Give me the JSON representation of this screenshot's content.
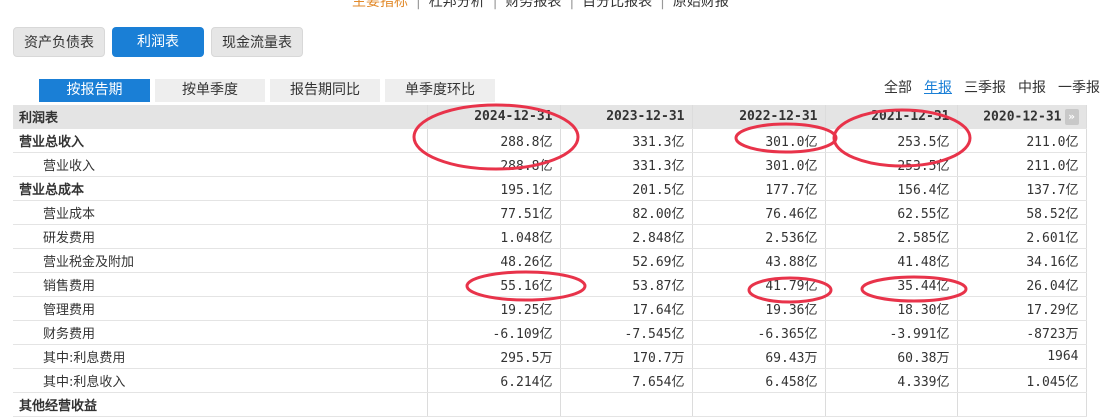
{
  "top_nav": {
    "items": [
      "主要指标",
      "杜邦分析",
      "财务报表",
      "百分比报表",
      "原始财报"
    ],
    "separator": "|"
  },
  "statement_tabs": [
    "资产负债表",
    "利润表",
    "现金流量表"
  ],
  "view_tabs": [
    "按报告期",
    "按单季度",
    "报告期同比",
    "单季度环比"
  ],
  "period_filters": [
    "全部",
    "年报",
    "三季报",
    "中报",
    "一季报"
  ],
  "table": {
    "header": [
      "利润表",
      "2024-12-31",
      "2023-12-31",
      "2022-12-31",
      "2021-12-31",
      "2020-12-31"
    ],
    "next_icon": "»",
    "rows": [
      {
        "label": "营业总收入",
        "values": [
          "288.8亿",
          "331.3亿",
          "301.0亿",
          "253.5亿",
          "211.0亿"
        ]
      },
      {
        "label": "营业收入",
        "values": [
          "288.8亿",
          "331.3亿",
          "301.0亿",
          "253.5亿",
          "211.0亿"
        ]
      },
      {
        "label": "营业总成本",
        "values": [
          "195.1亿",
          "201.5亿",
          "177.7亿",
          "156.4亿",
          "137.7亿"
        ]
      },
      {
        "label": "营业成本",
        "values": [
          "77.51亿",
          "82.00亿",
          "76.46亿",
          "62.55亿",
          "58.52亿"
        ]
      },
      {
        "label": "研发费用",
        "values": [
          "1.048亿",
          "2.848亿",
          "2.536亿",
          "2.585亿",
          "2.601亿"
        ]
      },
      {
        "label": "营业税金及附加",
        "values": [
          "48.26亿",
          "52.69亿",
          "43.88亿",
          "41.48亿",
          "34.16亿"
        ]
      },
      {
        "label": "销售费用",
        "values": [
          "55.16亿",
          "53.87亿",
          "41.79亿",
          "35.44亿",
          "26.04亿"
        ]
      },
      {
        "label": "管理费用",
        "values": [
          "19.25亿",
          "17.64亿",
          "19.36亿",
          "18.30亿",
          "17.29亿"
        ]
      },
      {
        "label": "财务费用",
        "values": [
          "-6.109亿",
          "-7.545亿",
          "-6.365亿",
          "-3.991亿",
          "-8723万"
        ]
      },
      {
        "label": "其中:利息费用",
        "values": [
          "295.5万",
          "170.7万",
          "69.43万",
          "60.38万",
          "1964"
        ]
      },
      {
        "label": "其中:利息收入",
        "values": [
          "6.214亿",
          "7.654亿",
          "6.458亿",
          "4.339亿",
          "1.045亿"
        ]
      },
      {
        "label": "其他经营收益",
        "values": [
          "",
          "",
          "",
          "",
          ""
        ]
      }
    ]
  },
  "colors": {
    "accent_blue": "#1a7fd6",
    "annotation_red": "#e8334a",
    "active_nav_orange": "#e28a2b"
  }
}
